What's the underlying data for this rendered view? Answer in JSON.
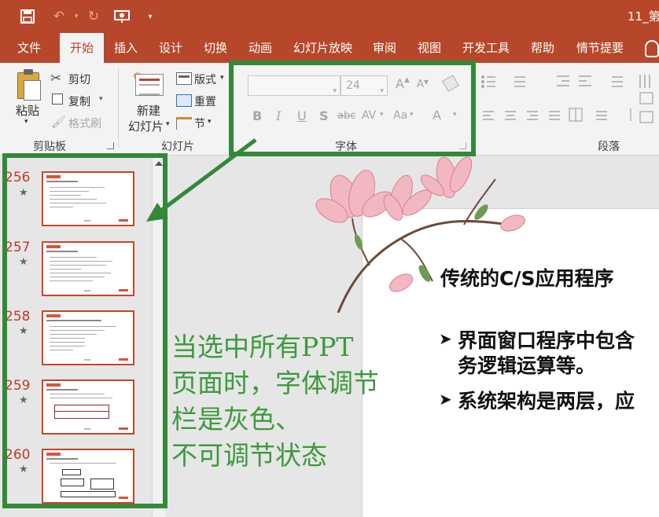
{
  "window": {
    "title": "11_第"
  },
  "quick_access": {
    "save_icon": "save-icon",
    "undo_icon": "undo-icon",
    "redo_icon": "redo-icon",
    "present_icon": "present-from-start-icon",
    "customize_icon": "customize-toolbar-icon"
  },
  "tabs": [
    {
      "label": "文件"
    },
    {
      "label": "开始"
    },
    {
      "label": "插入"
    },
    {
      "label": "设计"
    },
    {
      "label": "切换"
    },
    {
      "label": "动画"
    },
    {
      "label": "幻灯片放映"
    },
    {
      "label": "审阅"
    },
    {
      "label": "视图"
    },
    {
      "label": "开发工具"
    },
    {
      "label": "帮助"
    },
    {
      "label": "情节提要"
    }
  ],
  "active_tab": "开始",
  "clipboard": {
    "paste": "粘贴",
    "cut": "剪切",
    "copy": "复制",
    "format_painter": "格式刷",
    "group_label": "剪贴板"
  },
  "slides_group": {
    "new_slide_line1": "新建",
    "new_slide_line2": "幻灯片",
    "layout": "版式",
    "reset": "重置",
    "section": "节",
    "group_label": "幻灯片"
  },
  "font_group": {
    "font_name": "",
    "font_size": "24",
    "bold": "B",
    "italic": "I",
    "underline": "U",
    "shadow": "S",
    "strikethrough": "abc",
    "spacing": "AV",
    "change_case": "Aa",
    "font_color": "A",
    "group_label": "字体",
    "state": "disabled"
  },
  "paragraph_group": {
    "group_label": "段落"
  },
  "thumbnails": [
    {
      "number": "256",
      "star": "★"
    },
    {
      "number": "257",
      "star": "★"
    },
    {
      "number": "258",
      "star": "★"
    },
    {
      "number": "259",
      "star": "★"
    },
    {
      "number": "260",
      "star": "★"
    }
  ],
  "slide": {
    "title": "传统的C/S应用程序",
    "bullets": [
      {
        "line1": "界面窗口程序中包含",
        "line2": "务逻辑运算等。"
      },
      {
        "line1": "系统架构是两层，应"
      }
    ],
    "bullet_marker": "➤"
  },
  "annotation": {
    "lines": [
      "当选中所有PPT",
      "页面时，字体调节",
      "栏是灰色、",
      "不可调节状态"
    ],
    "color": "#3d9a3d"
  },
  "colors": {
    "brand": "#b7472a",
    "highlight_box": "#34883a"
  }
}
